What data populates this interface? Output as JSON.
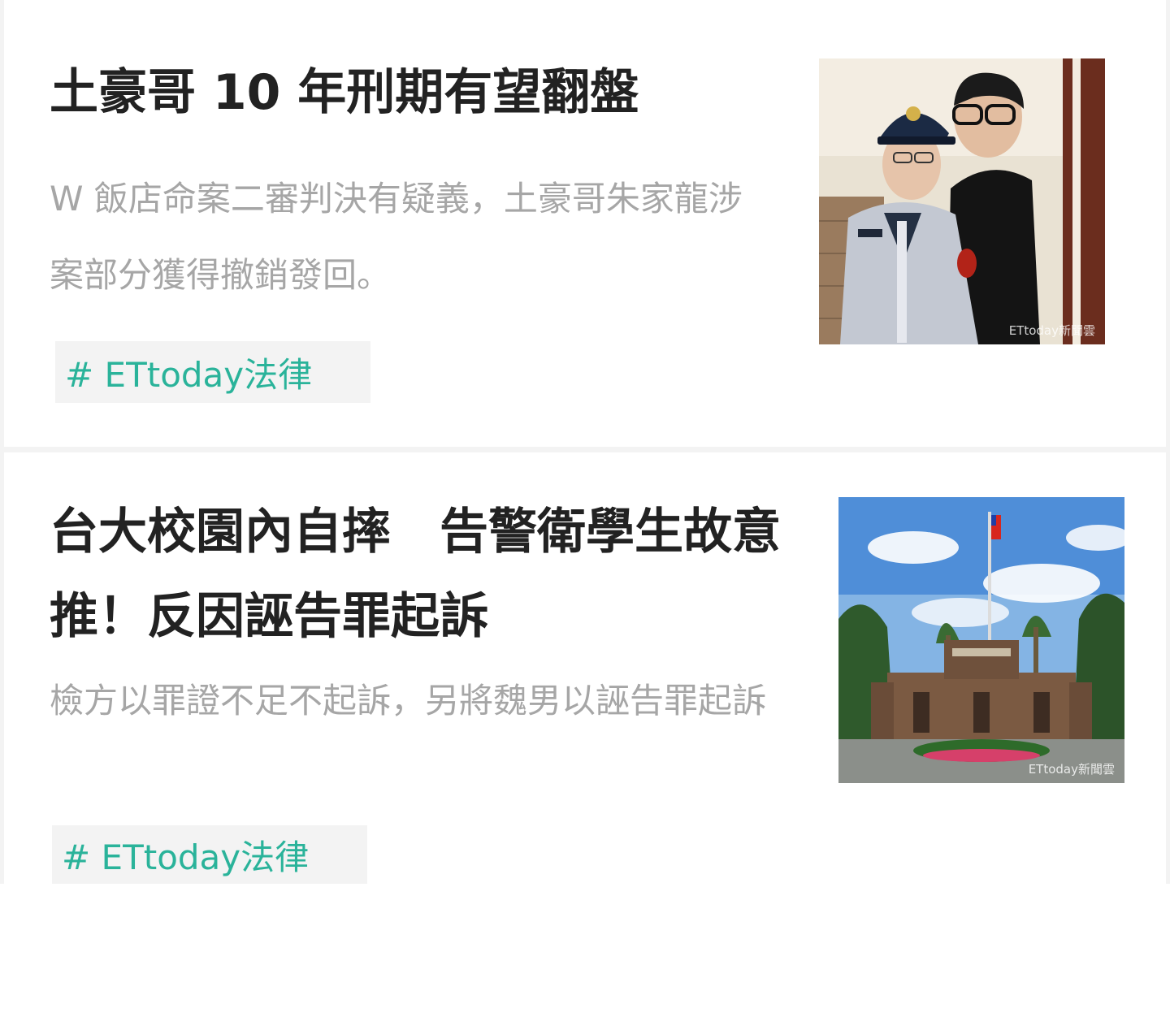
{
  "articles": [
    {
      "title": "土豪哥 10 年刑期有望翻盤",
      "summary": "W 飯店命案二審判決有疑義，土豪哥朱家龍涉案部分獲得撤銷發回。",
      "tag": "# ETtoday法律",
      "thumbnail_watermark": "ETtoday新聞雲"
    },
    {
      "title": "台大校園內自摔　告警衛學生故意推！反因誣告罪起訴",
      "summary": "檢方以罪證不足不起訴，另將魏男以誣告罪起訴",
      "tag": "# ETtoday法律",
      "thumbnail_watermark": "ETtoday新聞雲"
    }
  ]
}
